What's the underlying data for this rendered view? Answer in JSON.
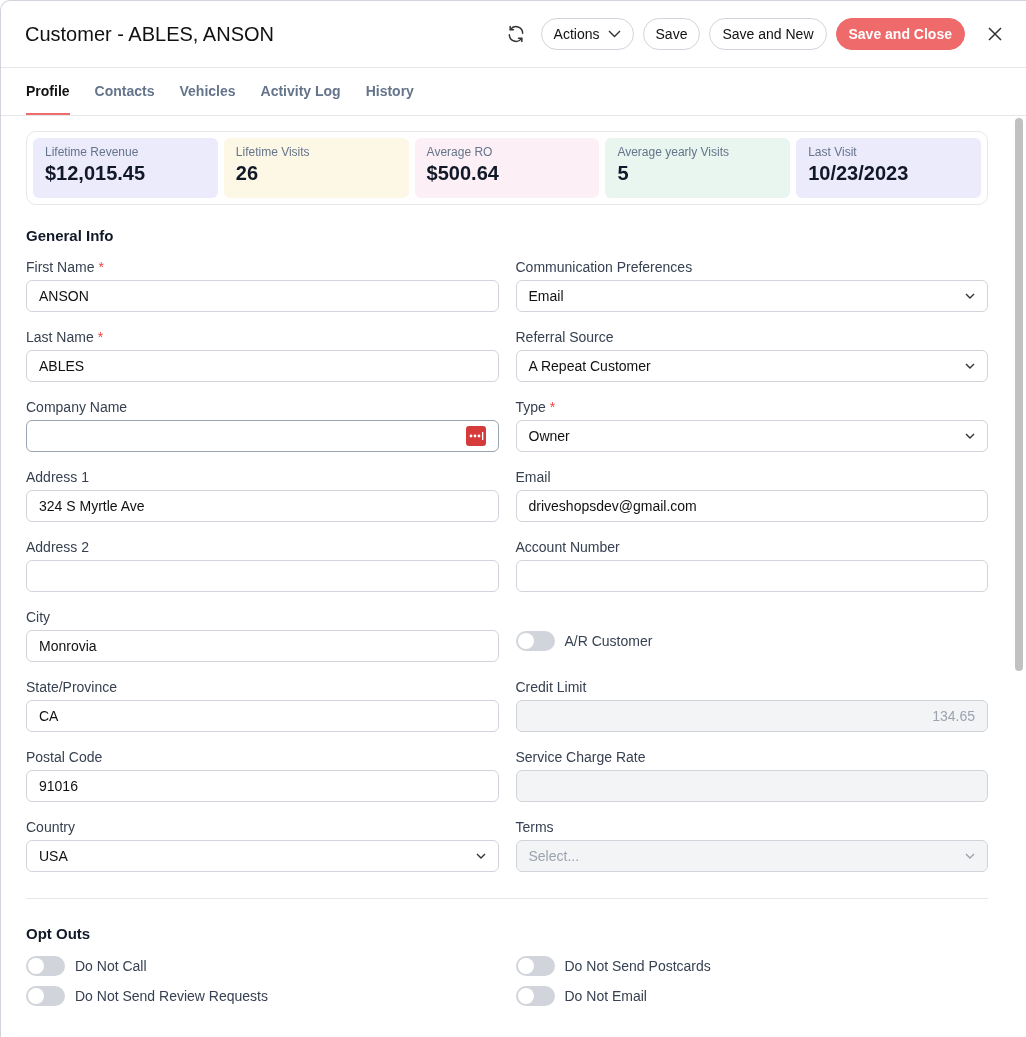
{
  "window": {
    "title": "Customer - ABLES, ANSON"
  },
  "header_buttons": [
    {
      "label": "Actions",
      "kind": "dropdown"
    },
    {
      "label": "Save",
      "kind": "outline"
    },
    {
      "label": "Save and New",
      "kind": "outline"
    },
    {
      "label": "Save and Close",
      "kind": "primary"
    }
  ],
  "tabs": [
    {
      "label": "Profile",
      "selected": true
    },
    {
      "label": "Contacts",
      "selected": false
    },
    {
      "label": "Vehicles",
      "selected": false
    },
    {
      "label": "Activity Log",
      "selected": false
    },
    {
      "label": "History",
      "selected": false
    }
  ],
  "stats": [
    {
      "label": "Lifetime Revenue",
      "value": "$12,015.45",
      "color": "#ecebfc"
    },
    {
      "label": "Lifetime Visits",
      "value": "26",
      "color": "#fdf7e6"
    },
    {
      "label": "Average RO",
      "value": "$500.64",
      "color": "#fcf0f6"
    },
    {
      "label": "Average yearly Visits",
      "value": "5",
      "color": "#e8f6ef"
    },
    {
      "label": "Last Visit",
      "value": "10/23/2023",
      "color": "#ecebfc"
    }
  ],
  "general_info": {
    "title": "General Info",
    "left_fields": [
      {
        "kind": "text",
        "label": "First Name",
        "required_mark": "*",
        "value": "ANSON"
      },
      {
        "kind": "text",
        "label": "Last Name",
        "required_mark": "*",
        "value": "ABLES"
      },
      {
        "kind": "text",
        "label": "Company Name",
        "focused": true,
        "autofill_icon": true
      },
      {
        "kind": "text",
        "label": "Address 1",
        "value": "324 S Myrtle Ave"
      },
      {
        "kind": "text",
        "label": "Address 2"
      },
      {
        "kind": "text",
        "label": "City",
        "value": "Monrovia"
      },
      {
        "kind": "text",
        "label": "State/Province",
        "value": "CA"
      },
      {
        "kind": "text",
        "label": "Postal Code",
        "value": "91016"
      },
      {
        "kind": "select",
        "label": "Country",
        "value": "USA"
      }
    ],
    "right_fields": [
      {
        "kind": "select",
        "label": "Communication Preferences",
        "value": "Email"
      },
      {
        "kind": "select",
        "label": "Referral Source",
        "value": "A Repeat Customer"
      },
      {
        "kind": "select",
        "label": "Type",
        "required_mark": "*",
        "value": "Owner"
      },
      {
        "kind": "text",
        "label": "Email",
        "value": "driveshopsdev@gmail.com"
      },
      {
        "kind": "text",
        "label": "Account Number"
      },
      {
        "kind": "toggle",
        "label": "A/R Customer",
        "on": false
      },
      {
        "kind": "text",
        "label": "Credit Limit",
        "disabled": true,
        "value": "134.65"
      },
      {
        "kind": "text",
        "label": "Service Charge Rate",
        "disabled": true
      },
      {
        "kind": "select",
        "label": "Terms",
        "disabled": true,
        "placeholder": "Select..."
      }
    ]
  },
  "opt_outs": {
    "title": "Opt Outs",
    "items": [
      {
        "label": "Do Not Call",
        "on": false
      },
      {
        "label": "Do Not Send Postcards",
        "on": false
      },
      {
        "label": "Do Not Send Review Requests",
        "on": false
      },
      {
        "label": "Do Not Email",
        "on": false
      }
    ]
  }
}
